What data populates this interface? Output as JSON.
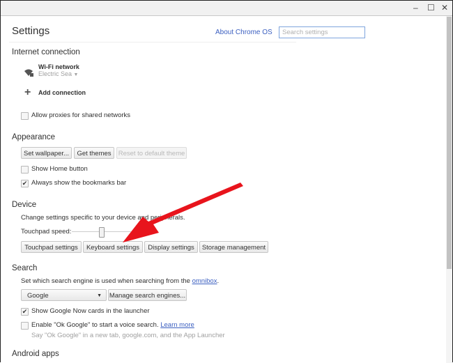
{
  "window": {
    "minimize": "–",
    "maximize": "☐",
    "close": "✕"
  },
  "header": {
    "title": "Settings",
    "about_link": "About Chrome OS",
    "search_placeholder": "Search settings"
  },
  "internet": {
    "heading": "Internet connection",
    "network_label": "Wi-Fi network",
    "network_name": "Electric Sea",
    "add_connection": "Add connection",
    "allow_proxies": {
      "label": "Allow proxies for shared networks",
      "checked": false
    }
  },
  "appearance": {
    "heading": "Appearance",
    "buttons": [
      "Set wallpaper...",
      "Get themes",
      "Reset to default theme"
    ],
    "show_home": {
      "label": "Show Home button",
      "checked": false
    },
    "bookmarks_bar": {
      "label": "Always show the bookmarks bar",
      "checked": true
    }
  },
  "device": {
    "heading": "Device",
    "description": "Change settings specific to your device and peripherals.",
    "touchpad_speed_label": "Touchpad speed:",
    "touchpad_speed_percent": 50,
    "buttons": [
      "Touchpad settings",
      "Keyboard settings",
      "Display settings",
      "Storage management"
    ]
  },
  "search": {
    "heading": "Search",
    "description": "Set which search engine is used when searching from the",
    "omnibox_link": "omnibox",
    "period": ".",
    "engine": "Google",
    "manage_button": "Manage search engines...",
    "google_now": {
      "label": "Show Google Now cards in the launcher",
      "checked": true
    },
    "ok_google": {
      "label": "Enable \"Ok Google\" to start a voice search.",
      "checked": false,
      "learn_more": "Learn more",
      "hint": "Say \"Ok Google\" in a new tab, google.com, and the App Launcher"
    }
  },
  "android": {
    "heading": "Android apps"
  },
  "annotation": {
    "color": "#e8141c"
  }
}
